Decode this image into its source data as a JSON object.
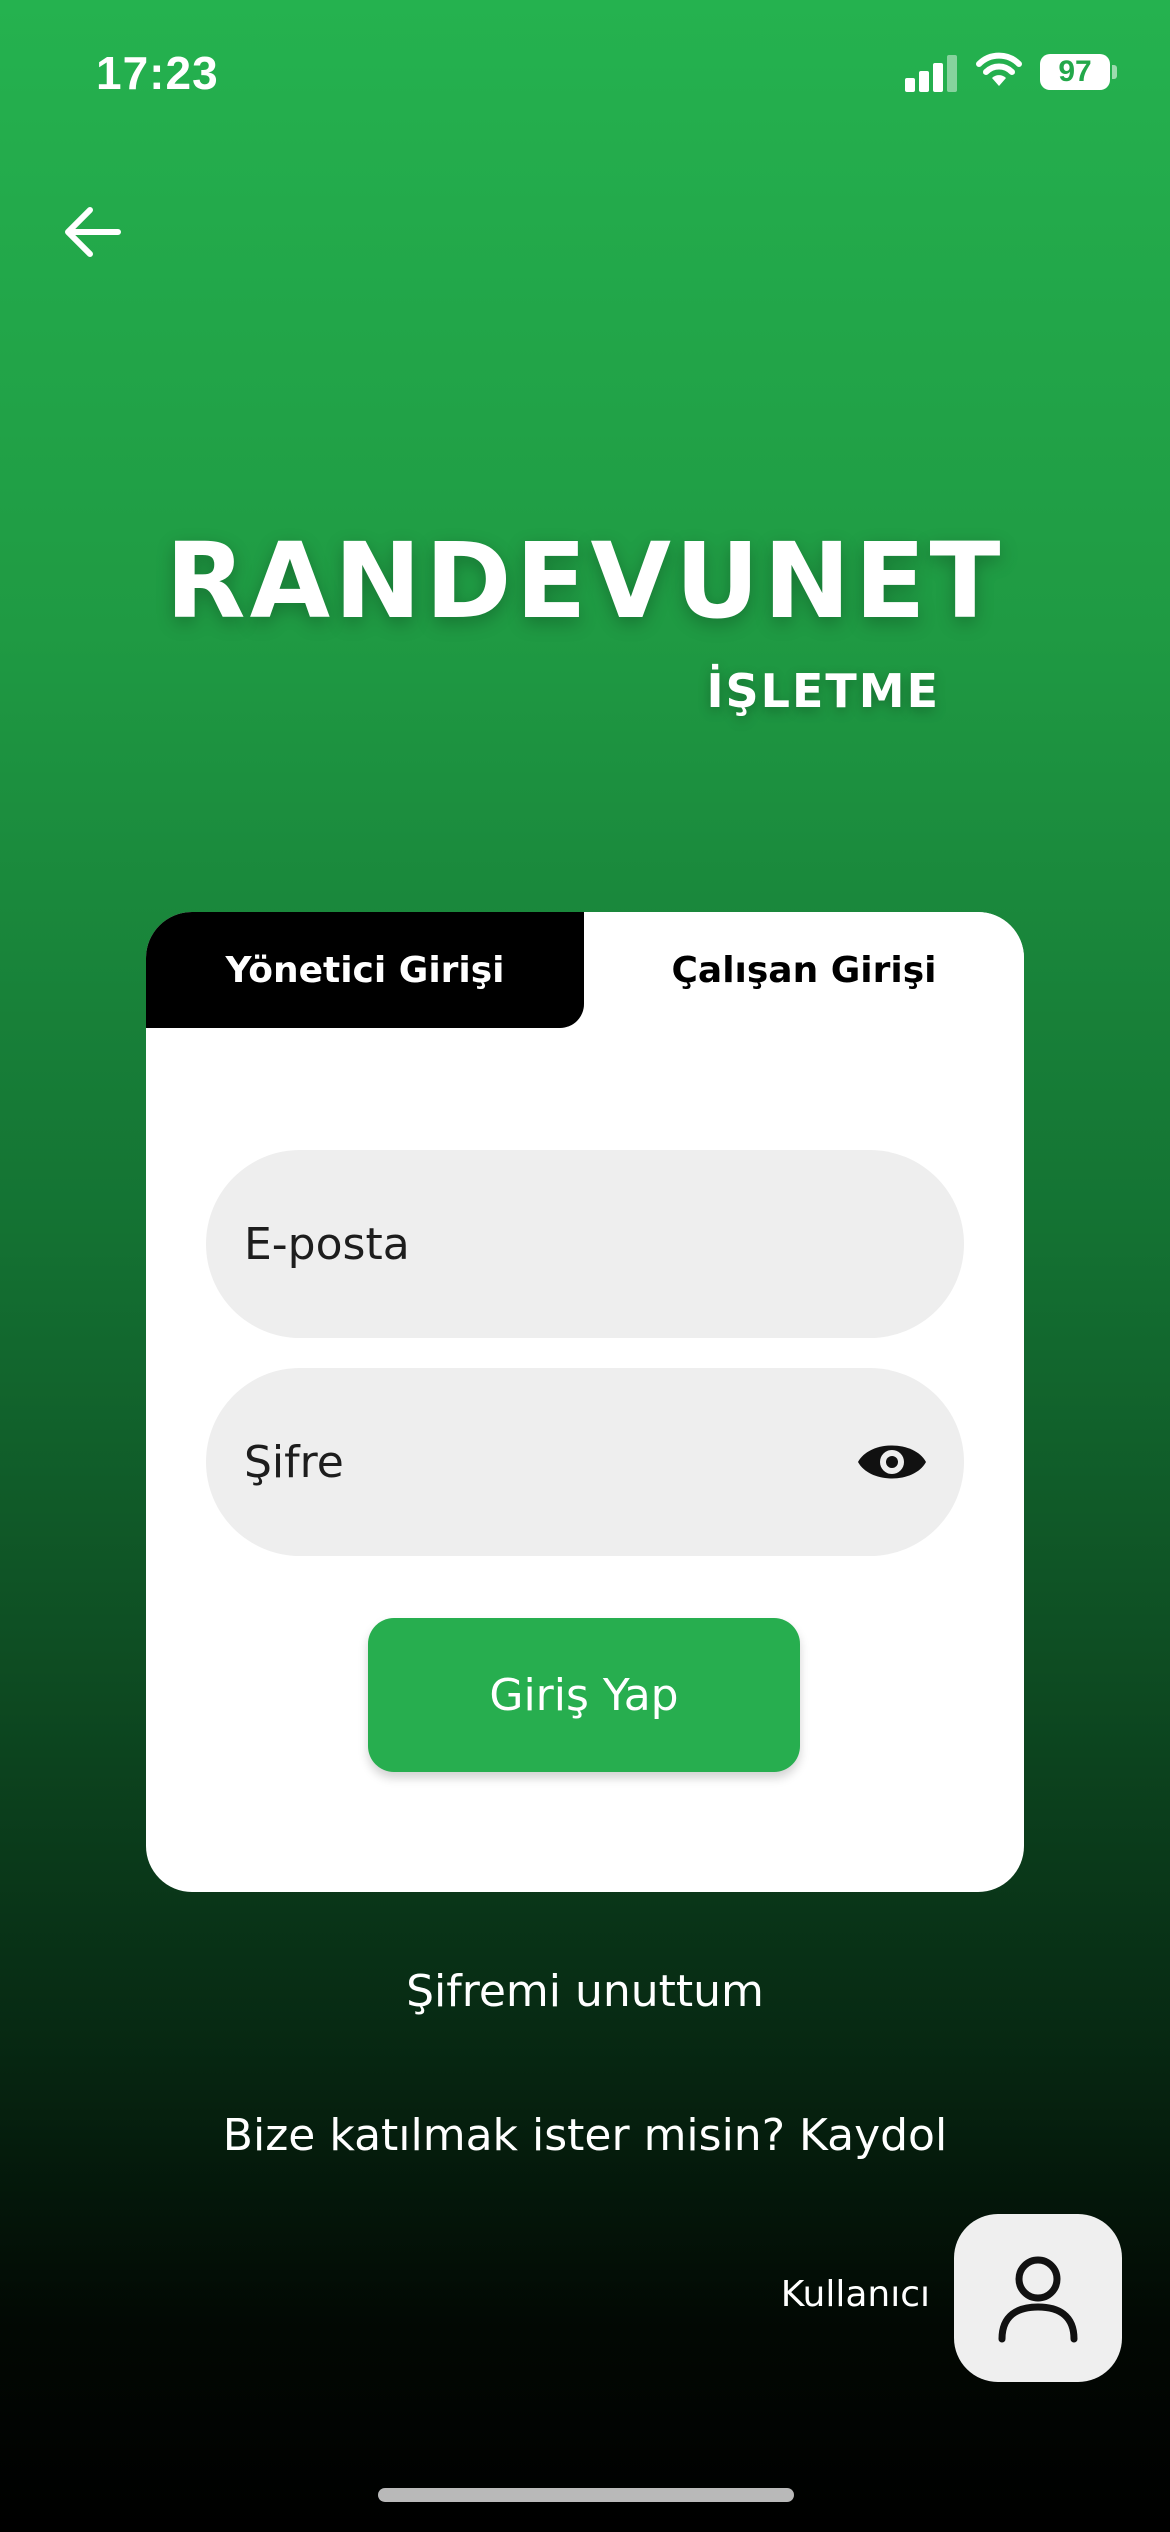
{
  "status_bar": {
    "time": "17:23",
    "battery": "97"
  },
  "brand": {
    "title": "RANDEVUNET",
    "subtitle": "İŞLETME"
  },
  "tabs": {
    "admin": "Yönetici Girişi",
    "employee": "Çalışan Girişi",
    "selected": "admin"
  },
  "form": {
    "email_placeholder": "E-posta",
    "password_placeholder": "Şifre",
    "submit_label": "Giriş Yap"
  },
  "links": {
    "forgot_password": "Şifremi unuttum",
    "signup_prompt": "Bize katılmak ister misin? Kaydol"
  },
  "user_mode": {
    "label": "Kullanıcı",
    "icon": "person-icon"
  },
  "icons": {
    "back": "arrow-left-icon",
    "password_visibility": "eye-icon"
  },
  "colors": {
    "accent": "#27ae4f",
    "gradient_top": "#25b24f",
    "gradient_bottom": "#000000",
    "active_tab": "#000000"
  }
}
